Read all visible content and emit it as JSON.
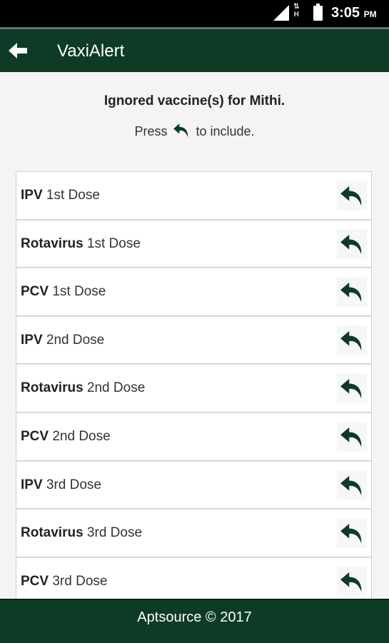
{
  "status_bar": {
    "time": "3:05",
    "ampm": "PM",
    "network": "H"
  },
  "app_bar": {
    "title": "VaxiAlert"
  },
  "heading": "Ignored vaccine(s) for Mithi.",
  "instruction": {
    "before": "Press",
    "after": "to include."
  },
  "items": [
    {
      "name": "IPV",
      "dose": "1st Dose"
    },
    {
      "name": "Rotavirus",
      "dose": "1st Dose"
    },
    {
      "name": "PCV",
      "dose": "1st Dose"
    },
    {
      "name": "IPV",
      "dose": "2nd Dose"
    },
    {
      "name": "Rotavirus",
      "dose": "2nd Dose"
    },
    {
      "name": "PCV",
      "dose": "2nd Dose"
    },
    {
      "name": "IPV",
      "dose": "3rd Dose"
    },
    {
      "name": "Rotavirus",
      "dose": "3rd Dose"
    },
    {
      "name": "PCV",
      "dose": "3rd Dose"
    }
  ],
  "footer": "Aptsource © 2017",
  "colors": {
    "primary": "#0d3b26",
    "icon": "#0d3b26"
  }
}
